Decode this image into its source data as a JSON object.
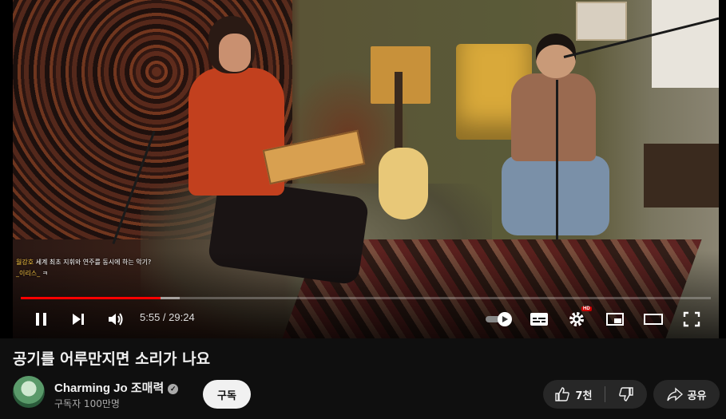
{
  "video": {
    "title": "공기를 어루만지면 소리가 나요",
    "current_time": "5:55",
    "duration": "29:24",
    "time_display": "5:55 / 29:24",
    "progress_played": 0.202,
    "progress_loaded": 0.23,
    "quality_badge": "HD"
  },
  "chat_overlay": [
    {
      "user": "월강호",
      "message": "세계 최초 지휘와 연주를 동시에 하는 악기?"
    },
    {
      "user": "_이리스_",
      "message": "ㅋ"
    }
  ],
  "channel": {
    "name": "Charming Jo 조매력",
    "subscribers": "구독자 100만명",
    "verified": true
  },
  "actions": {
    "subscribe_label": "구독",
    "like_count": "7천",
    "share_label": "공유"
  },
  "colors": {
    "progress": "#ff0000",
    "background": "#0f0f0f",
    "button_bg": "#272727"
  },
  "icons": [
    "pause-icon",
    "next-icon",
    "volume-icon",
    "autoplay-toggle-icon",
    "captions-icon",
    "settings-icon",
    "miniplayer-icon",
    "theater-icon",
    "fullscreen-icon",
    "like-icon",
    "dislike-icon",
    "share-icon",
    "verified-icon"
  ]
}
